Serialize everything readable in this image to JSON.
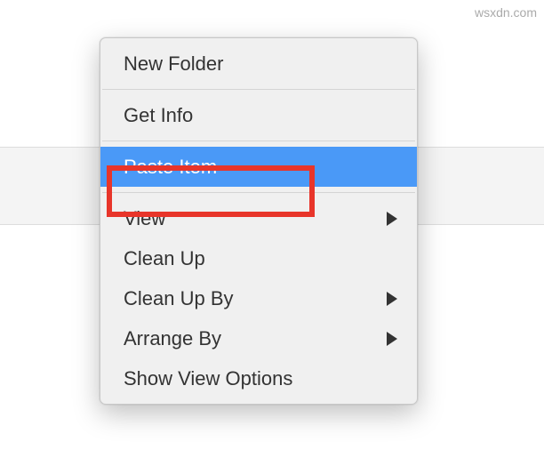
{
  "menu": {
    "items": [
      {
        "label": "New Folder",
        "hasSubmenu": false
      },
      {
        "type": "separator"
      },
      {
        "label": "Get Info",
        "hasSubmenu": false
      },
      {
        "type": "separator"
      },
      {
        "label": "Paste Item",
        "hasSubmenu": false,
        "highlighted": true
      },
      {
        "type": "separator"
      },
      {
        "label": "View",
        "hasSubmenu": true
      },
      {
        "label": "Clean Up",
        "hasSubmenu": false
      },
      {
        "label": "Clean Up By",
        "hasSubmenu": true
      },
      {
        "label": "Arrange By",
        "hasSubmenu": true
      },
      {
        "label": "Show View Options",
        "hasSubmenu": false
      }
    ]
  },
  "watermark": "wsxdn.com"
}
